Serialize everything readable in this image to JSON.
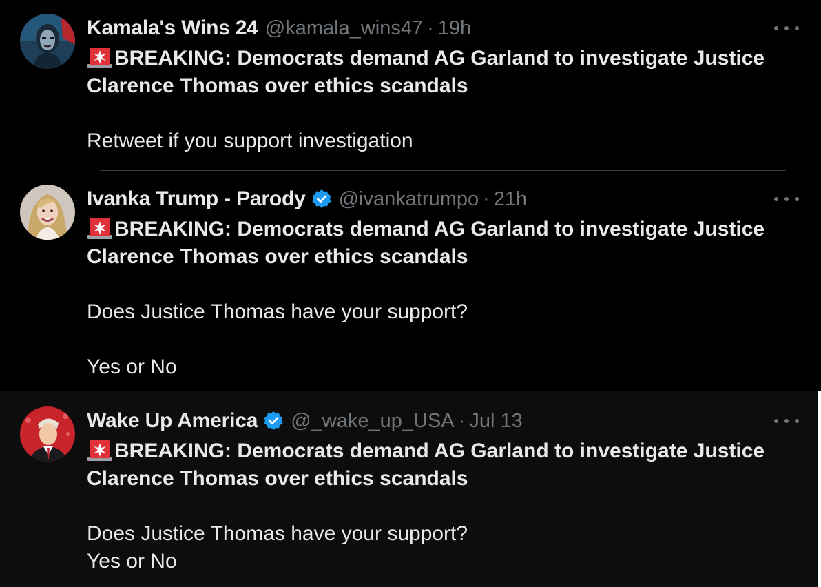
{
  "tweets": [
    {
      "name": "Kamala's Wins 24",
      "verified": false,
      "handle": "@kamala_wins47",
      "separator": "·",
      "time": "19h",
      "headline_line1": "BREAKING: Democrats demand AG Garland to investigate Justice",
      "headline_line2": "Clarence Thomas over ethics scandals",
      "line_a": "Retweet if you support investigation",
      "line_b": "",
      "avatar_icon": "woman-portrait-avatar"
    },
    {
      "name": "Ivanka Trump - Parody",
      "verified": true,
      "handle": "@ivankatrumpo",
      "separator": "·",
      "time": "21h",
      "headline_line1": "BREAKING: Democrats demand AG Garland to investigate Justice",
      "headline_line2": "Clarence Thomas over ethics scandals",
      "line_a": "Does Justice Thomas have your support?",
      "line_b": "Yes or No",
      "avatar_icon": "blonde-woman-avatar"
    },
    {
      "name": "Wake Up America",
      "verified": true,
      "handle": "@_wake_up_USA",
      "separator": "·",
      "time": "Jul 13",
      "headline_line1": "BREAKING: Democrats demand AG Garland to investigate Justice",
      "headline_line2": "Clarence Thomas over ethics scandals",
      "line_a": "Does Justice Thomas have your support?",
      "line_b": "Yes or No",
      "avatar_icon": "man-red-background-avatar"
    }
  ],
  "icons": {
    "siren": "police-siren-emoji",
    "verified": "verified-badge-icon",
    "more": "more-options-icon"
  },
  "colors": {
    "background": "#000000",
    "highlight_background": "#0d0d0d",
    "text": "#e7e9ea",
    "secondary_text": "#71767b",
    "verified_blue": "#1d9bf0",
    "siren_red": "#e0313b"
  }
}
